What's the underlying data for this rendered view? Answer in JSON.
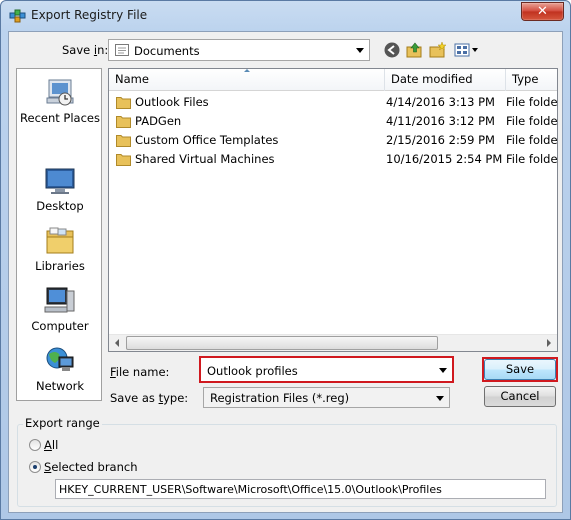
{
  "window": {
    "title": "Export Registry File",
    "close_glyph": "✕"
  },
  "toolbar": {
    "save_in_label": "Save in:",
    "save_in_value": "Documents"
  },
  "places": [
    {
      "label": "Recent Places",
      "icon": "recent-places-icon"
    },
    {
      "label": "Desktop",
      "icon": "desktop-icon"
    },
    {
      "label": "Libraries",
      "icon": "libraries-icon"
    },
    {
      "label": "Computer",
      "icon": "computer-icon"
    },
    {
      "label": "Network",
      "icon": "network-icon"
    }
  ],
  "file_list": {
    "columns": [
      "Name",
      "Date modified",
      "Type"
    ],
    "rows": [
      {
        "name": "Outlook Files",
        "date": "4/14/2016 3:13 PM",
        "type": "File folder"
      },
      {
        "name": "PADGen",
        "date": "4/11/2016 3:12 PM",
        "type": "File folder"
      },
      {
        "name": "Custom Office Templates",
        "date": "2/15/2016 2:59 PM",
        "type": "File folder"
      },
      {
        "name": "Shared Virtual Machines",
        "date": "10/16/2015 2:54 PM",
        "type": "File folder"
      }
    ]
  },
  "form": {
    "file_name_label": "File name:",
    "file_name_value": "Outlook profiles",
    "save_type_label": "Save as type:",
    "save_type_value": "Registration Files (*.reg)",
    "save_button": "Save",
    "cancel_button": "Cancel"
  },
  "export_range": {
    "title": "Export range",
    "all_label": "All",
    "selected_label": "Selected branch",
    "selected": "Selected branch",
    "branch_path": "HKEY_CURRENT_USER\\Software\\Microsoft\\Office\\15.0\\Outlook\\Profiles"
  },
  "colors": {
    "highlight": "#d0191f",
    "accent": "#3c7fb1"
  }
}
